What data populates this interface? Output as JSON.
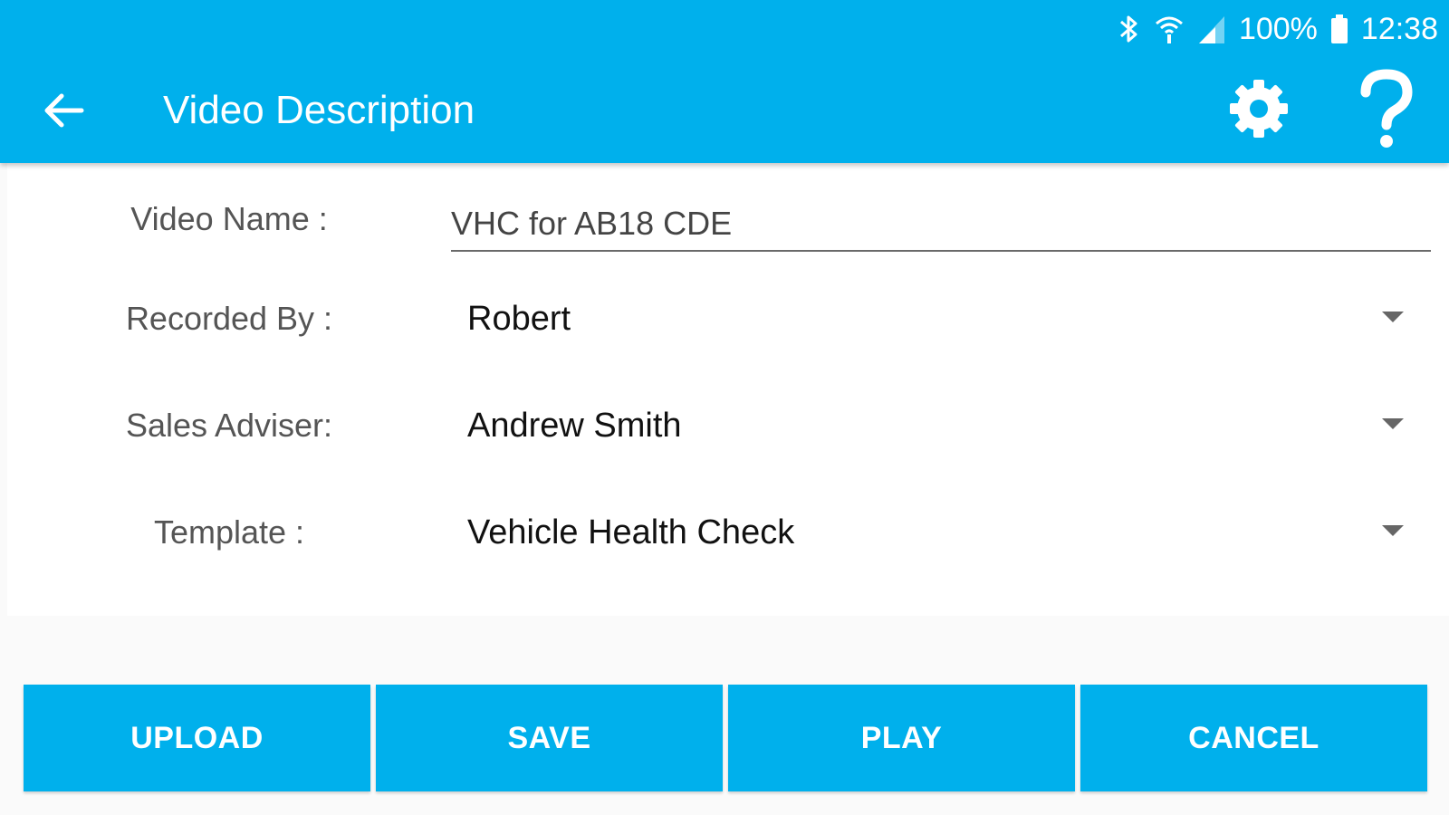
{
  "status_bar": {
    "battery_percent": "100%",
    "time": "12:38"
  },
  "toolbar": {
    "title": "Video Description"
  },
  "form": {
    "video_name": {
      "label": "Video Name :",
      "value": "VHC for AB18 CDE"
    },
    "recorded_by": {
      "label": "Recorded By :",
      "selected": "Robert"
    },
    "sales_adviser": {
      "label": "Sales Adviser:",
      "selected": "Andrew Smith"
    },
    "template": {
      "label": "Template :",
      "selected": "Vehicle Health Check"
    }
  },
  "actions": {
    "upload": "UPLOAD",
    "save": "SAVE",
    "play": "PLAY",
    "cancel": "CANCEL"
  },
  "colors": {
    "primary": "#00b0ec",
    "on_primary": "#ffffff",
    "label_text": "#555555",
    "value_text": "#111111"
  },
  "icons": {
    "back": "arrow-back-icon",
    "settings": "gear-icon",
    "help": "question-mark-icon",
    "bluetooth": "bluetooth-icon",
    "wifi": "wifi-icon",
    "signal": "cellular-signal-icon",
    "battery": "battery-icon",
    "dropdown": "chevron-down-icon"
  }
}
